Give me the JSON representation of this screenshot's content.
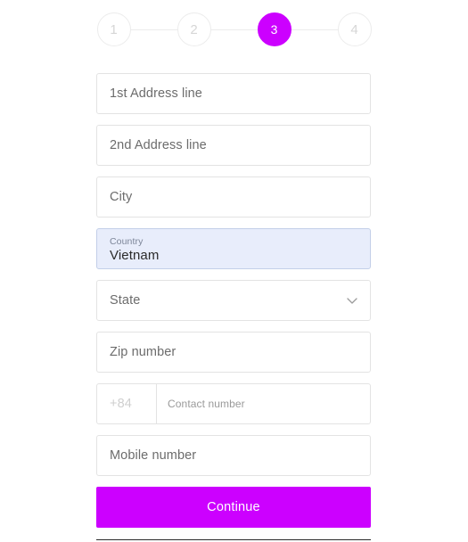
{
  "stepper": {
    "steps": [
      {
        "label": "1",
        "state": "inactive"
      },
      {
        "label": "2",
        "state": "inactive"
      },
      {
        "label": "3",
        "state": "active"
      },
      {
        "label": "4",
        "state": "inactive"
      }
    ],
    "active_color": "#cc00ff",
    "inactive_color": "#d6d6d6",
    "line_color": "#ececec"
  },
  "form": {
    "address_line_1": {
      "placeholder": "1st Address line",
      "value": ""
    },
    "address_line_2": {
      "placeholder": "2nd Address line",
      "value": ""
    },
    "city": {
      "placeholder": "City",
      "value": ""
    },
    "country": {
      "label": "Country",
      "value": "Vietnam",
      "focused": true,
      "background_color": "#e8edfb",
      "border_color": "#c3cfe8"
    },
    "state": {
      "placeholder": "State",
      "value": "",
      "icon": "chevron-down-icon"
    },
    "zip": {
      "placeholder": "Zip number",
      "value": ""
    },
    "phone": {
      "country_code": "+84",
      "contact_placeholder": "Contact number",
      "contact_value": ""
    },
    "mobile": {
      "placeholder": "Mobile number",
      "value": ""
    }
  },
  "actions": {
    "continue_label": "Continue",
    "continue_color": "#cc00ff"
  }
}
